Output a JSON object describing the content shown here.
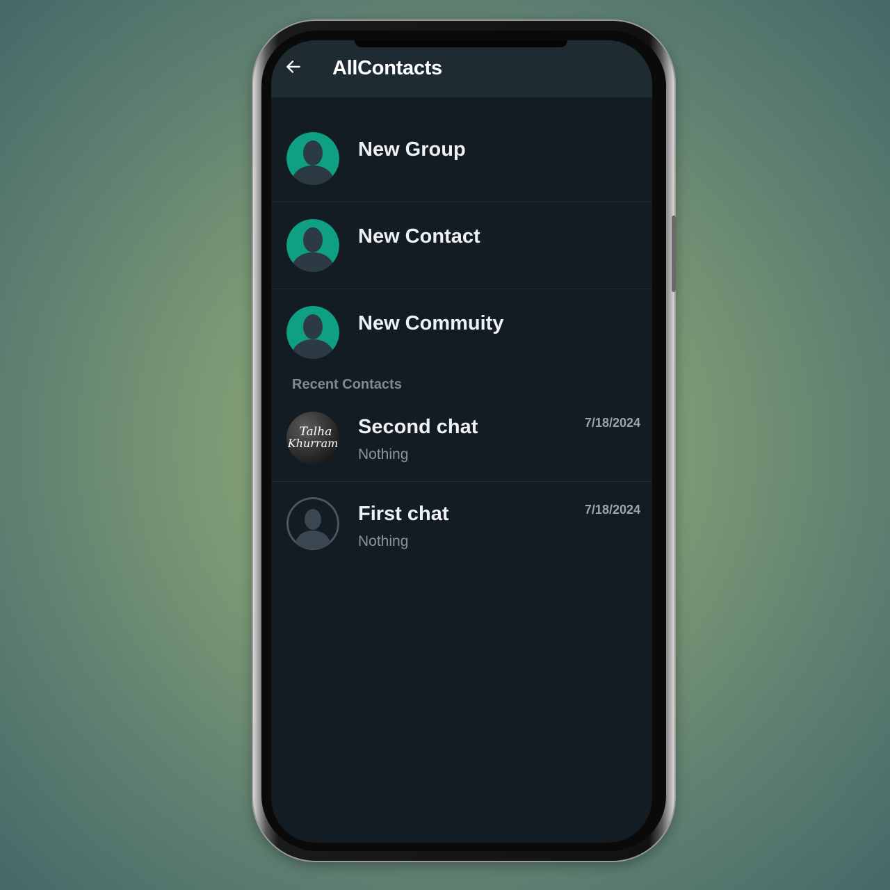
{
  "header": {
    "title": "AllContacts",
    "back_icon": "arrow-left-icon"
  },
  "actions": [
    {
      "label": "New Group",
      "icon": "person-silhouette-icon"
    },
    {
      "label": "New Contact",
      "icon": "person-silhouette-icon"
    },
    {
      "label": "New Commuity",
      "icon": "person-silhouette-icon"
    }
  ],
  "recent": {
    "section_label": "Recent Contacts",
    "chats": [
      {
        "name": "Second chat",
        "preview": "Nothing",
        "date": "7/18/2024",
        "avatar_text_line1": "Talha",
        "avatar_text_line2": "Khurram"
      },
      {
        "name": "First chat",
        "preview": "Nothing",
        "date": "7/18/2024",
        "avatar_icon": "person-silhouette-icon"
      }
    ]
  },
  "colors": {
    "accent": "#0fa083",
    "screen_background": "#131b23",
    "app_bar": "#1f2b33",
    "primary_text": "#eef2f4",
    "secondary_text": "#8a969e"
  }
}
